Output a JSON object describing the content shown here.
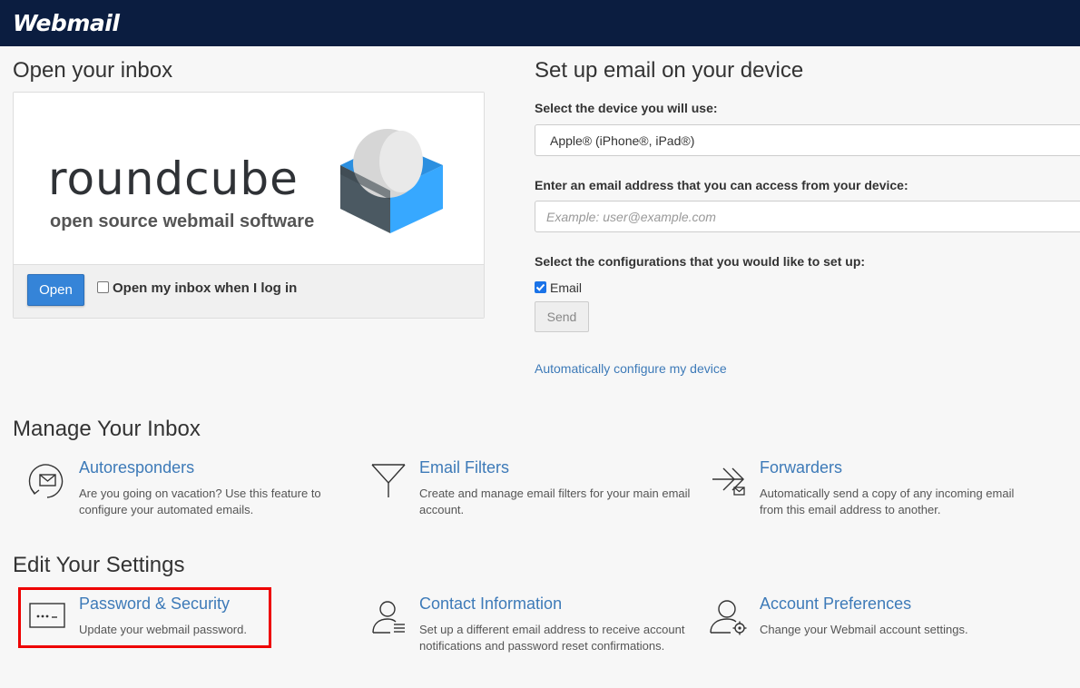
{
  "header": {
    "brand": "Webmail"
  },
  "open_inbox": {
    "heading": "Open your inbox",
    "logo_word": "roundcube",
    "logo_tagline": "open source webmail software",
    "open_button": "Open",
    "open_on_login_label": "Open my inbox when I log in",
    "open_on_login_checked": false
  },
  "setup": {
    "heading": "Set up email on your device",
    "device_label": "Select the device you will use:",
    "device_value": "Apple® (iPhone®, iPad®)",
    "email_label": "Enter an email address that you can access from your device:",
    "email_placeholder": "Example: user@example.com",
    "config_label": "Select the configurations that you would like to set up:",
    "email_option": "Email",
    "email_option_checked": true,
    "send_button": "Send",
    "auto_config_link": "Automatically configure my device"
  },
  "manage": {
    "heading": "Manage Your Inbox",
    "items": [
      {
        "title": "Autoresponders",
        "desc": "Are you going on vacation? Use this feature to configure your automated emails.",
        "icon": "autoresponder-icon"
      },
      {
        "title": "Email Filters",
        "desc": "Create and manage email filters for your main email account.",
        "icon": "filter-icon"
      },
      {
        "title": "Forwarders",
        "desc": "Automatically send a copy of any incoming email from this email address to another.",
        "icon": "forwarder-icon"
      }
    ]
  },
  "settings": {
    "heading": "Edit Your Settings",
    "items": [
      {
        "title": "Password & Security",
        "desc": "Update your webmail password.",
        "icon": "password-icon"
      },
      {
        "title": "Contact Information",
        "desc": "Set up a different email address to receive account notifications and password reset confirmations.",
        "icon": "contact-icon"
      },
      {
        "title": "Account Preferences",
        "desc": "Change your Webmail account settings.",
        "icon": "account-preferences-icon"
      }
    ]
  },
  "colors": {
    "header_bg": "#0b1d40",
    "link": "#3d7ab8",
    "primary_button": "#3584d8",
    "highlight": "#e00000"
  }
}
